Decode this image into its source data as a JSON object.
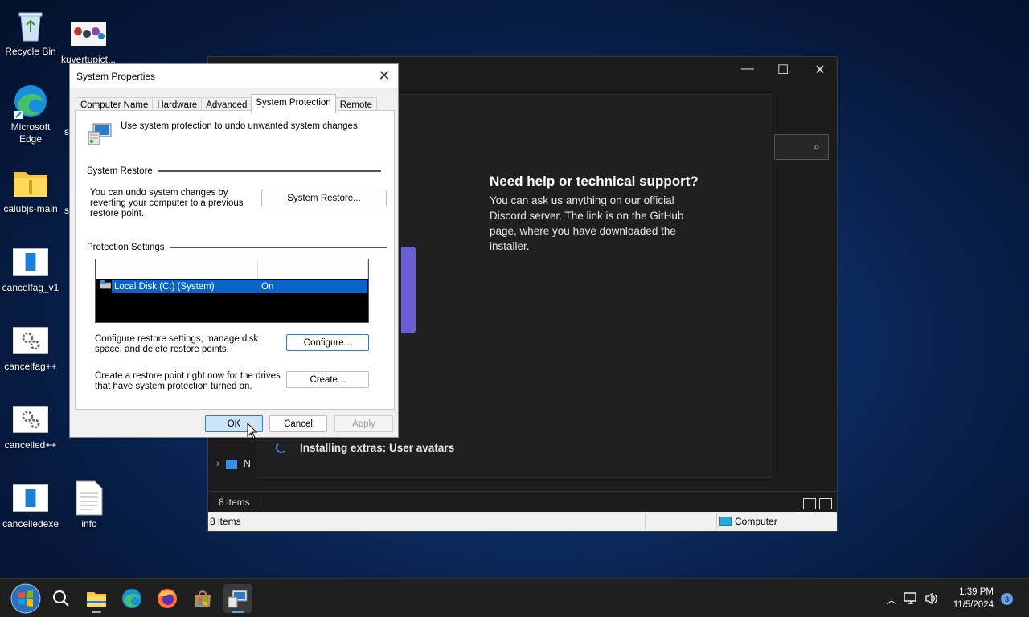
{
  "desktop": {
    "icons": [
      {
        "label": "Recycle Bin",
        "icon": "recycle-bin-icon"
      },
      {
        "label": "kuvertupict...",
        "icon": "image-file-icon"
      },
      {
        "label": "Microsoft Edge",
        "icon": "edge-icon"
      },
      {
        "label": "calubjs-main",
        "icon": "folder-icon"
      },
      {
        "label": "cancelfag_v1",
        "icon": "app-window-icon"
      },
      {
        "label": "cancelfag++",
        "icon": "gear-app-icon"
      },
      {
        "label": "cancelled++",
        "icon": "gear-app-icon"
      },
      {
        "label": "cancelledexe",
        "icon": "app-window-icon"
      },
      {
        "label": "info",
        "icon": "text-file-icon"
      },
      {
        "label": "s",
        "icon": ""
      }
    ]
  },
  "explorer": {
    "minimize": "—",
    "maximize": "☐",
    "close": "✕",
    "search_icon": "⌕",
    "nav_item_label": "N",
    "status_count": "8 items",
    "status_sep": "|",
    "bottom_items": "8 items",
    "bottom_location": "Computer"
  },
  "installer": {
    "help_title": "Need help or technical support?",
    "help_body": "You can ask us anything on our official Discord server. The link is on the GitHub page, where you have downloaded the installer.",
    "status": "Installing extras: User avatars"
  },
  "dialog": {
    "title": "System Properties",
    "close": "✕",
    "tabs": [
      "Computer Name",
      "Hardware",
      "Advanced",
      "System Protection",
      "Remote"
    ],
    "active_tab": "System Protection",
    "intro": "Use system protection to undo unwanted system changes.",
    "restore_group": "System Restore",
    "restore_text": "You can undo system changes by reverting your computer to a previous restore point.",
    "restore_button": "System Restore...",
    "protection_group": "Protection Settings",
    "drives": [
      {
        "name": "Local Disk (C:) (System)",
        "protection": "On"
      }
    ],
    "configure_text": "Configure restore settings, manage disk space, and delete restore points.",
    "configure_button": "Configure...",
    "create_text": "Create a restore point right now for the drives that have system protection turned on.",
    "create_button": "Create...",
    "ok": "OK",
    "cancel": "Cancel",
    "apply": "Apply"
  },
  "taskbar": {
    "apps": [
      "start-orb",
      "search",
      "file-explorer",
      "edge",
      "firefox",
      "store",
      "system-properties"
    ],
    "time": "1:39 PM",
    "date": "11/5/2024",
    "notifications": "3"
  },
  "colors": {
    "selection": "#0a64c8",
    "accent": "#2a7ad5",
    "installer_accent": "#6b5dd3"
  }
}
